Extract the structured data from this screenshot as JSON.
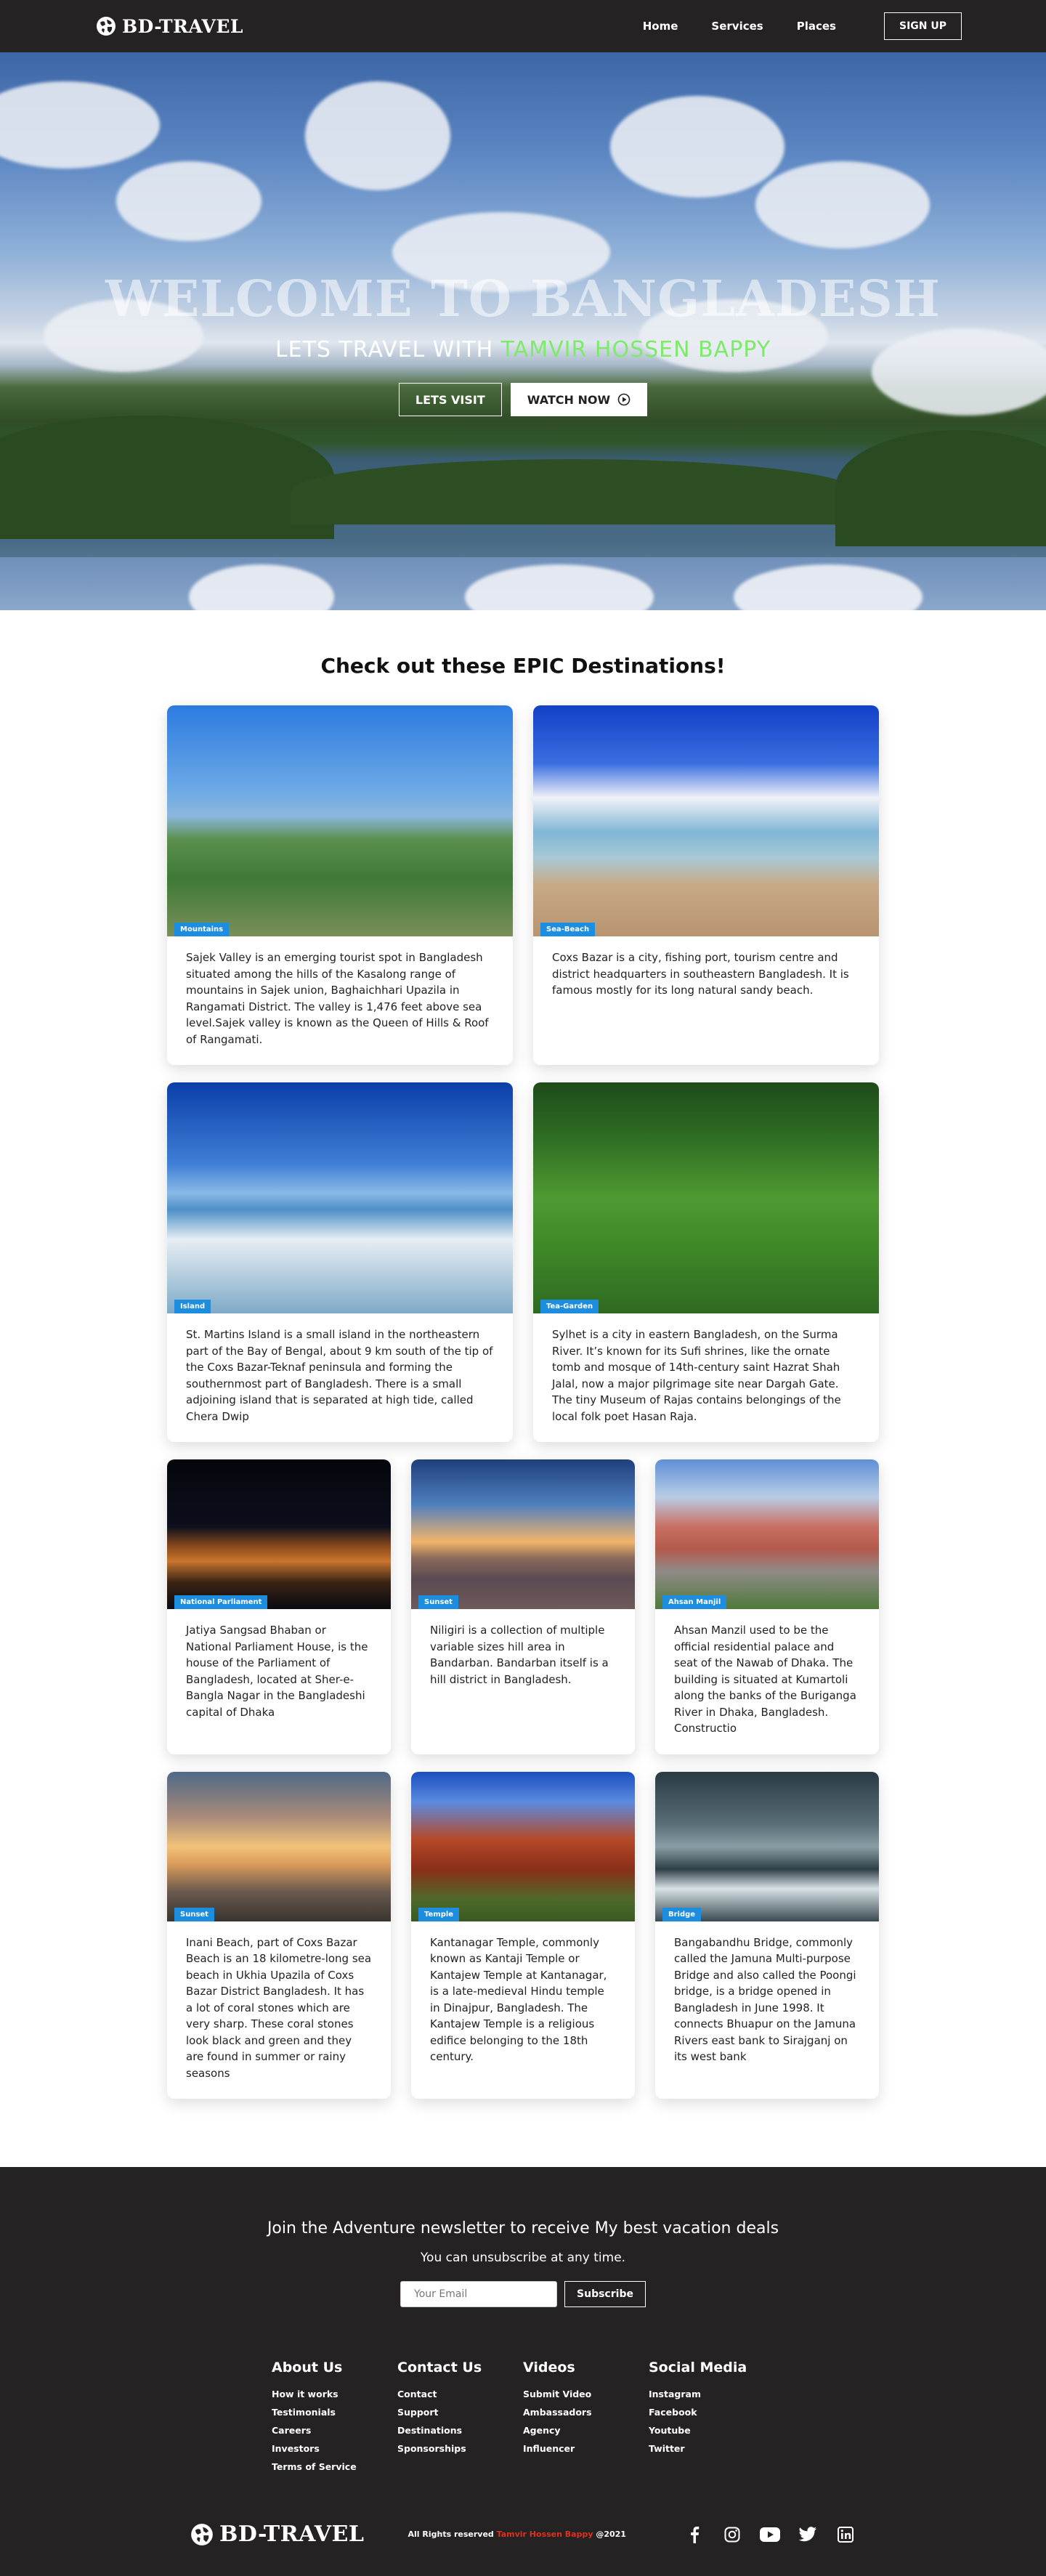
{
  "nav": {
    "brand": "BD-TRAVEL",
    "links": [
      "Home",
      "Services",
      "Places"
    ],
    "signup": "SIGN UP"
  },
  "hero": {
    "title": "WELCOME TO BANGLADESH",
    "subtitle_prefix": "LETS TRAVEL WITH ",
    "subtitle_highlight": "TAMVIR HOSSEN BAPPY",
    "btn_visit": "LETS VISIT",
    "btn_watch": "WATCH NOW",
    "highlight_color": "#7dea6a"
  },
  "destinations": {
    "title": "Check out these EPIC Destinations!",
    "cards": [
      {
        "badge": "Mountains",
        "text": "Sajek Valley is an emerging tourist spot in Bangladesh situated among the hills of the Kasalong range of mountains in Sajek union, Baghaichhari Upazila in Rangamati District. The valley is 1,476 feet above sea level.Sajek valley is known as the Queen of Hills & Roof of Rangamati."
      },
      {
        "badge": "Sea-Beach",
        "text": "Coxs Bazar is a city, fishing port, tourism centre and district headquarters in southeastern Bangladesh. It is famous mostly for its long natural sandy beach."
      },
      {
        "badge": "Island",
        "text": "St. Martins Island is a small island in the northeastern part of the Bay of Bengal, about 9 km south of the tip of the Coxs Bazar-Teknaf peninsula and forming the southernmost part of Bangladesh. There is a small adjoining island that is separated at high tide, called Chera Dwip"
      },
      {
        "badge": "Tea-Garden",
        "text": "Sylhet is a city in eastern Bangladesh, on the Surma River. It’s known for its Sufi shrines, like the ornate tomb and mosque of 14th-century saint Hazrat Shah Jalal, now a major pilgrimage site near Dargah Gate. The tiny Museum of Rajas contains belongings of the local folk poet Hasan Raja."
      },
      {
        "badge": "National Parliament",
        "text": "Jatiya Sangsad Bhaban or National Parliament House, is the house of the Parliament of Bangladesh, located at Sher-e-Bangla Nagar in the Bangladeshi capital of Dhaka"
      },
      {
        "badge": "Sunset",
        "text": "Niligiri is a collection of multiple variable sizes hill area in Bandarban. Bandarban itself is a hill district in Bangladesh."
      },
      {
        "badge": "Ahsan Manjil",
        "text": "Ahsan Manzil used to be the official residential palace and seat of the Nawab of Dhaka. The building is situated at Kumartoli along the banks of the Buriganga River in Dhaka, Bangladesh. Constructio"
      },
      {
        "badge": "Sunset",
        "text": "Inani Beach, part of Coxs Bazar Beach is an 18 kilometre-long sea beach in Ukhia Upazila of Coxs Bazar District Bangladesh. It has a lot of coral stones which are very sharp. These coral stones look black and green and they are found in summer or rainy seasons"
      },
      {
        "badge": "Temple",
        "text": "Kantanagar Temple, commonly known as Kantaji Temple or Kantajew Temple at Kantanagar, is a late-medieval Hindu temple in Dinajpur, Bangladesh. The Kantajew Temple is a religious edifice belonging to the 18th century."
      },
      {
        "badge": "Bridge",
        "text": "Bangabandhu Bridge, commonly called the Jamuna Multi-purpose Bridge and also called the Poongi bridge, is a bridge opened in Bangladesh in June 1998. It connects Bhuapur on the Jamuna Rivers east bank to Sirajganj on its west bank"
      }
    ]
  },
  "footer": {
    "newsletter_title": "Join the Adventure newsletter to receive My best vacation deals",
    "newsletter_sub": "You can unsubscribe at any time.",
    "email_placeholder": "Your Email",
    "subscribe": "Subscribe",
    "columns": [
      {
        "title": "About Us",
        "links": [
          "How it works",
          "Testimonials",
          "Careers",
          "Investors",
          "Terms of Service"
        ]
      },
      {
        "title": "Contact Us",
        "links": [
          "Contact",
          "Support",
          "Destinations",
          "Sponsorships"
        ]
      },
      {
        "title": "Videos",
        "links": [
          "Submit Video",
          "Ambassadors",
          "Agency",
          "Influencer"
        ]
      },
      {
        "title": "Social Media",
        "links": [
          "Instagram",
          "Facebook",
          "Youtube",
          "Twitter"
        ]
      }
    ],
    "brand": "BD-TRAVEL",
    "copy_prefix": "All Rights reserved ",
    "copy_name": "Tamvir Hossen Bappy",
    "copy_year": " @2021",
    "social_icons": [
      "facebook-icon",
      "instagram-icon",
      "youtube-icon",
      "twitter-icon",
      "linkedin-icon"
    ]
  },
  "colors": {
    "nav_bg": "#242222",
    "badge": "#1d8de0",
    "footer_bg": "#242222",
    "copyright_red": "#e0301e"
  }
}
